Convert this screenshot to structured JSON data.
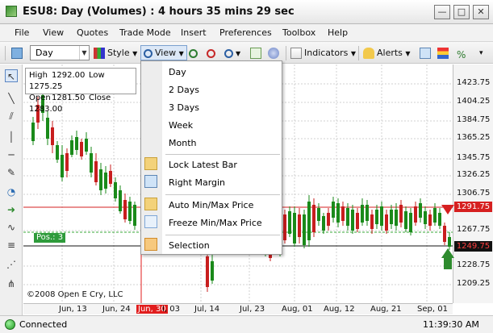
{
  "window": {
    "title": "ESU8: Day (Volumes) : 4 hours 35 mins 29 sec",
    "minimize_glyph": "—",
    "maximize_glyph": "□",
    "close_glyph": "✕"
  },
  "menubar": {
    "items": [
      "File",
      "View",
      "Quotes",
      "Trade Mode",
      "Insert",
      "Preferences",
      "Toolbox",
      "Help"
    ]
  },
  "toolbar": {
    "period_select": "Day",
    "style_label": "Style",
    "view_label": "View",
    "indicators_label": "Indicators",
    "alerts_label": "Alerts"
  },
  "ohlc": {
    "high_label": "High",
    "high_value": "1292.00",
    "low_label": "Low",
    "low_value": "1275.25",
    "open_label": "Open",
    "open_value": "1281.50",
    "close_label": "Close",
    "close_value": "1283.00"
  },
  "view_menu": {
    "items": [
      "Day",
      "2 Days",
      "3 Days",
      "Week",
      "Month"
    ],
    "lock_latest_bar": "Lock Latest Bar",
    "right_margin": "Right Margin",
    "auto_minmax": "Auto Min/Max Price",
    "freeze_minmax": "Freeze Min/Max Price",
    "selection": "Selection"
  },
  "chart": {
    "copyright": "©2008 Open E Cry, LLC",
    "position_label": "Pos.: 3",
    "price_labels": [
      "1423.75",
      "1404.25",
      "1384.75",
      "1365.25",
      "1345.75",
      "1326.25",
      "1306.75",
      "1267.75",
      "1228.75",
      "1209.25"
    ],
    "current_price_red": "1291.75",
    "current_price_black": "1249.75",
    "x_labels": [
      "Jun, 13",
      "Jun, 24",
      "Jun, 30",
      "I, 03",
      "Jul, 14",
      "Jul, 23",
      "Aug, 01",
      "Aug, 12",
      "Aug, 21",
      "Sep, 01"
    ]
  },
  "status": {
    "text": "Connected",
    "time": "11:39:30 AM"
  },
  "colors": {
    "up_candle": "#1a8a1a",
    "down_candle": "#c81e1e",
    "price_line_red": "#d62020",
    "price_line_green": "#3aa83a",
    "x_highlight": "#e11d1d"
  }
}
